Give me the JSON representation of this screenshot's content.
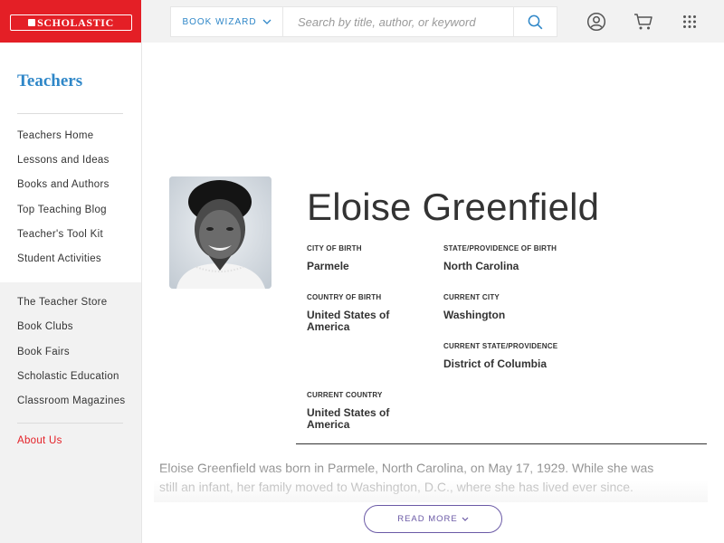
{
  "header": {
    "logo_text": "SCHOLASTIC",
    "book_wizard_label": "BOOK WIZARD",
    "search_placeholder": "Search by title, author, or keyword",
    "icons": [
      "user-account-icon",
      "shopping-cart-icon",
      "apps-grid-icon"
    ],
    "brand_color": "#e41f26",
    "accent_color": "#2f87c8"
  },
  "sidebar": {
    "title": "Teachers",
    "primary_links": [
      {
        "label": "Teachers Home"
      },
      {
        "label": "Lessons and Ideas"
      },
      {
        "label": "Books and Authors"
      },
      {
        "label": "Top Teaching Blog"
      },
      {
        "label": "Teacher's Tool Kit"
      },
      {
        "label": "Student Activities"
      }
    ],
    "secondary_links": [
      {
        "label": "The Teacher Store"
      },
      {
        "label": "Book Clubs"
      },
      {
        "label": "Book Fairs"
      },
      {
        "label": "Scholastic Education"
      },
      {
        "label": "Classroom Magazines"
      }
    ],
    "about_link": "About Us"
  },
  "profile": {
    "name": "Eloise Greenfield",
    "facts": {
      "city_of_birth": {
        "label": "CITY OF BIRTH",
        "value": "Parmele"
      },
      "state_of_birth": {
        "label": "STATE/PROVIDENCE OF BIRTH",
        "value": "North Carolina"
      },
      "country_of_birth": {
        "label": "COUNTRY OF BIRTH",
        "value": "United States of America"
      },
      "current_city": {
        "label": "CURRENT CITY",
        "value": "Washington"
      },
      "current_state": {
        "label": "CURRENT STATE/PROVIDENCE",
        "value": "District of Columbia"
      },
      "current_country": {
        "label": "CURRENT COUNTRY",
        "value": "United States of America"
      }
    },
    "bio": "Eloise Greenfield was born in Parmele, North Carolina, on May 17, 1929. While she was still an infant, her family moved to Washington, D.C., where she has lived ever since.",
    "read_more_label": "READ MORE"
  }
}
